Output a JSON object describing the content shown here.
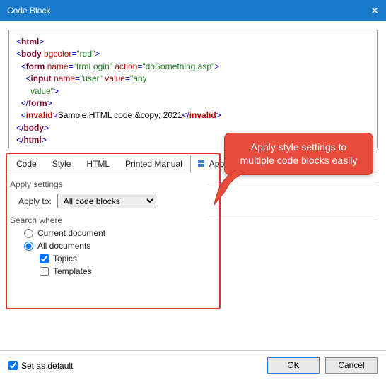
{
  "titlebar": {
    "title": "Code Block",
    "close": "✕"
  },
  "code": {
    "lines": [
      {
        "raw": "<html>"
      },
      {
        "raw": "<body bgcolor=\"red\">"
      },
      {
        "raw": "  <form name=\"frmLogin\" action=\"doSomething.asp\">"
      },
      {
        "raw": "    <input name=\"user\" value=\"any"
      },
      {
        "raw": "      value\">"
      },
      {
        "raw": "  </form>"
      },
      {
        "raw": "  <invalid>Sample HTML code &copy; 2021</invalid>"
      },
      {
        "raw": "</body>"
      },
      {
        "raw": "</html>"
      }
    ]
  },
  "tabs": {
    "items": [
      {
        "label": "Code"
      },
      {
        "label": "Style"
      },
      {
        "label": "HTML"
      },
      {
        "label": "Printed Manual"
      },
      {
        "label": "Apply to"
      }
    ],
    "activeIndex": 4
  },
  "apply": {
    "groupLabel": "Apply settings",
    "applyToLabel": "Apply to:",
    "applyToValue": "All code blocks",
    "searchLabel": "Search where",
    "radioCurrent": "Current document",
    "radioAll": "All documents",
    "checkTopics": "Topics",
    "checkTemplates": "Templates"
  },
  "callout": {
    "text": "Apply style settings to multiple code blocks easily"
  },
  "footer": {
    "setDefault": "Set as default",
    "ok": "OK",
    "cancel": "Cancel"
  }
}
